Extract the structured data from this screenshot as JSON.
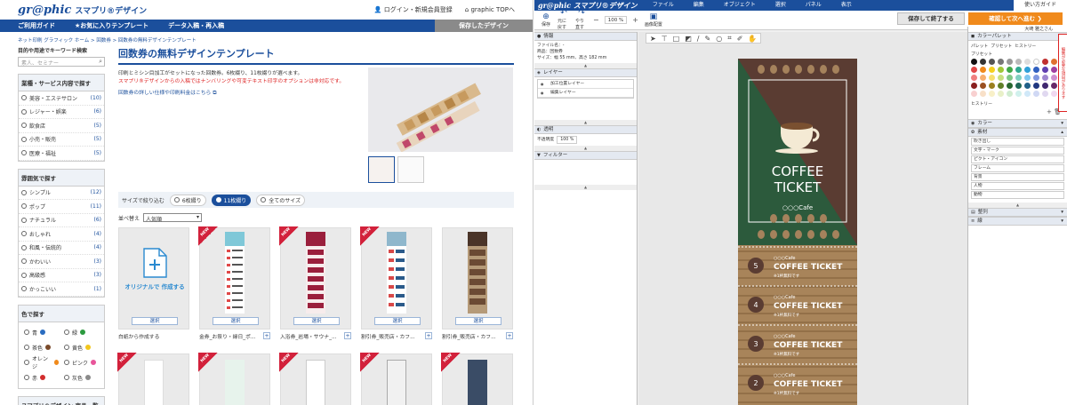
{
  "site": {
    "logo": "gr@phic",
    "logo_sub": "スマプリ®デザイン",
    "login": "ログイン・新規会員登録",
    "top_link": "graphic TOPへ",
    "nav": [
      "ご利用ガイド",
      "★お気に入りテンプレート",
      "データ入稿・再入稿"
    ],
    "saved_design": "保存したデザイン",
    "breadcrumb": "ネット印刷 グラフィック ホーム  >  回数券  >  回数券の無料デザインテンプレート",
    "search_caption": "目的や用途でキーワード検索",
    "search_placeholder": "素人、セミナー",
    "industry": {
      "title": "業種・サービス内容で探す",
      "items": [
        {
          "label": "美容・エステサロン",
          "count": "(10)"
        },
        {
          "label": "レジャー・娯楽",
          "count": "(6)"
        },
        {
          "label": "飲食店",
          "count": "(5)"
        },
        {
          "label": "小売・販売",
          "count": "(5)"
        },
        {
          "label": "医療・福祉",
          "count": "(5)"
        }
      ]
    },
    "mood": {
      "title": "雰囲気で探す",
      "items": [
        {
          "label": "シンプル",
          "count": "(12)"
        },
        {
          "label": "ポップ",
          "count": "(11)"
        },
        {
          "label": "ナチュラル",
          "count": "(6)"
        },
        {
          "label": "おしゃれ",
          "count": "(4)"
        },
        {
          "label": "和風・伝統的",
          "count": "(4)"
        },
        {
          "label": "かわいい",
          "count": "(3)"
        },
        {
          "label": "高級感",
          "count": "(3)"
        },
        {
          "label": "かっこいい",
          "count": "(1)"
        }
      ]
    },
    "color": {
      "title": "色で探す",
      "items": [
        {
          "label": "青",
          "hex": "#2a6cc0"
        },
        {
          "label": "緑",
          "hex": "#2b9a3f"
        },
        {
          "label": "茶色",
          "hex": "#7a4a2a"
        },
        {
          "label": "黄色",
          "hex": "#f2c61c"
        },
        {
          "label": "オレンジ",
          "hex": "#f08a1c"
        },
        {
          "label": "ピンク",
          "hex": "#e8559a"
        },
        {
          "label": "赤",
          "hex": "#d22d2d"
        },
        {
          "label": "灰色",
          "hex": "#8a8a8a"
        }
      ]
    },
    "side_footer": "スマプリ®デザイン 商品一覧",
    "page_title": "回数券の無料デザインテンプレート",
    "desc1": "印刷とミシン目加工がセットになった回数券。6枚綴り、11枚綴りが選べます。",
    "desc2": "スマプリ®デザインからの入稿ではナンバリングや可変テキスト印字のオプションは非対応です。",
    "desc_link": "回数券の詳しい仕様や印刷料金はこちら",
    "filter_label": "サイズで絞り込む",
    "filters": [
      "6枚綴り",
      "11枚綴り",
      "全てのサイズ"
    ],
    "sort_label": "並べ替え",
    "sort_value": "人気順",
    "new_label": "NEW",
    "select_label": "選択",
    "original_label": "オリジナルで 作成する",
    "cards": [
      {
        "caption": "白紙から作成する"
      },
      {
        "caption": "金券_お祭り・縁日_ポ..."
      },
      {
        "caption": "入浴券_岩場・サウナ_..."
      },
      {
        "caption": "割引券_販売店・カフ..."
      },
      {
        "caption": "割引券_販売店・カフ..."
      }
    ]
  },
  "editor": {
    "logo": "gr@phic スマプリ®デザイン",
    "menu": [
      "ファイル",
      "編集",
      "オブジェクト",
      "選択",
      "パネル",
      "表示"
    ],
    "help": "使い方ガイド",
    "toolbar": [
      "保存",
      "元に戻す",
      "やり直す",
      "画像配置"
    ],
    "zoom": "100 %",
    "save_exit": "保存して終了する",
    "next": "確認して次へ進む",
    "user": "大崎 雅之さん",
    "info_title": "情報",
    "info_lines": [
      "ファイル名：-",
      "商品：回数券",
      "サイズ：幅 55 mm、高さ 182 mm"
    ],
    "layer_title": "レイヤー",
    "layers": [
      "加工位置レイヤー",
      "編集レイヤー"
    ],
    "opacity_title": "透明",
    "opacity_label": "不透明度",
    "opacity_value": "100 %",
    "filter_title": "フィルター",
    "palette_title": "カラーパレット",
    "palette_tabs": [
      "パレット",
      "プリセット",
      "ヒストリー"
    ],
    "preset_label": "プリセット",
    "history_label": "ヒストリー",
    "color_title": "カラー",
    "material_title": "素材",
    "materials": [
      "吹き出し",
      "文字・マーク",
      "ピクト・アイコン",
      "フレーム",
      "背景",
      "人物",
      "動物"
    ],
    "align_title": "整列",
    "line_title": "線",
    "red_tab": "編集が必要な項目があります",
    "ticket": {
      "title1": "COFFEE",
      "title2": "TICKET",
      "cafe": "○○○Cafe",
      "stub_cafe": "○○○Cafe",
      "stub_title": "COFFEE TICKET",
      "stub_sub": "※1杯無料です",
      "numbers": [
        "5",
        "4",
        "3",
        "2"
      ]
    },
    "colors": {
      "brown": "#5a3c32",
      "green": "#2c5a3c",
      "wood": "#a8845a"
    }
  }
}
